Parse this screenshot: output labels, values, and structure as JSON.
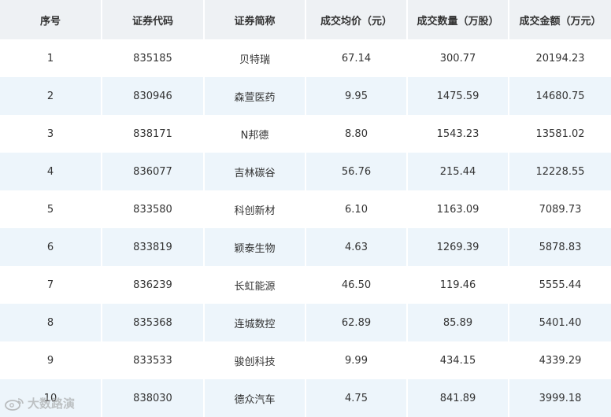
{
  "headers": [
    "序号",
    "证券代码",
    "证券简称",
    "成交均价（元）",
    "成交数量（万股）",
    "成交金额（万元）"
  ],
  "rows": [
    [
      "1",
      "835185",
      "贝特瑞",
      "67.14",
      "300.77",
      "20194.23"
    ],
    [
      "2",
      "830946",
      "森萱医药",
      "9.95",
      "1475.59",
      "14680.75"
    ],
    [
      "3",
      "838171",
      "N邦德",
      "8.80",
      "1543.23",
      "13581.02"
    ],
    [
      "4",
      "836077",
      "吉林碳谷",
      "56.76",
      "215.44",
      "12228.55"
    ],
    [
      "5",
      "833580",
      "科创新材",
      "6.10",
      "1163.09",
      "7089.73"
    ],
    [
      "6",
      "833819",
      "颖泰生物",
      "4.63",
      "1269.39",
      "5878.83"
    ],
    [
      "7",
      "836239",
      "长虹能源",
      "46.50",
      "119.46",
      "5555.44"
    ],
    [
      "8",
      "835368",
      "连城数控",
      "62.89",
      "85.89",
      "5401.40"
    ],
    [
      "9",
      "833533",
      "骏创科技",
      "9.99",
      "434.15",
      "4339.29"
    ],
    [
      "10",
      "838030",
      "德众汽车",
      "4.75",
      "841.89",
      "3999.18"
    ]
  ],
  "watermark": {
    "text": "大数路演",
    "icon": "weibo-icon"
  }
}
